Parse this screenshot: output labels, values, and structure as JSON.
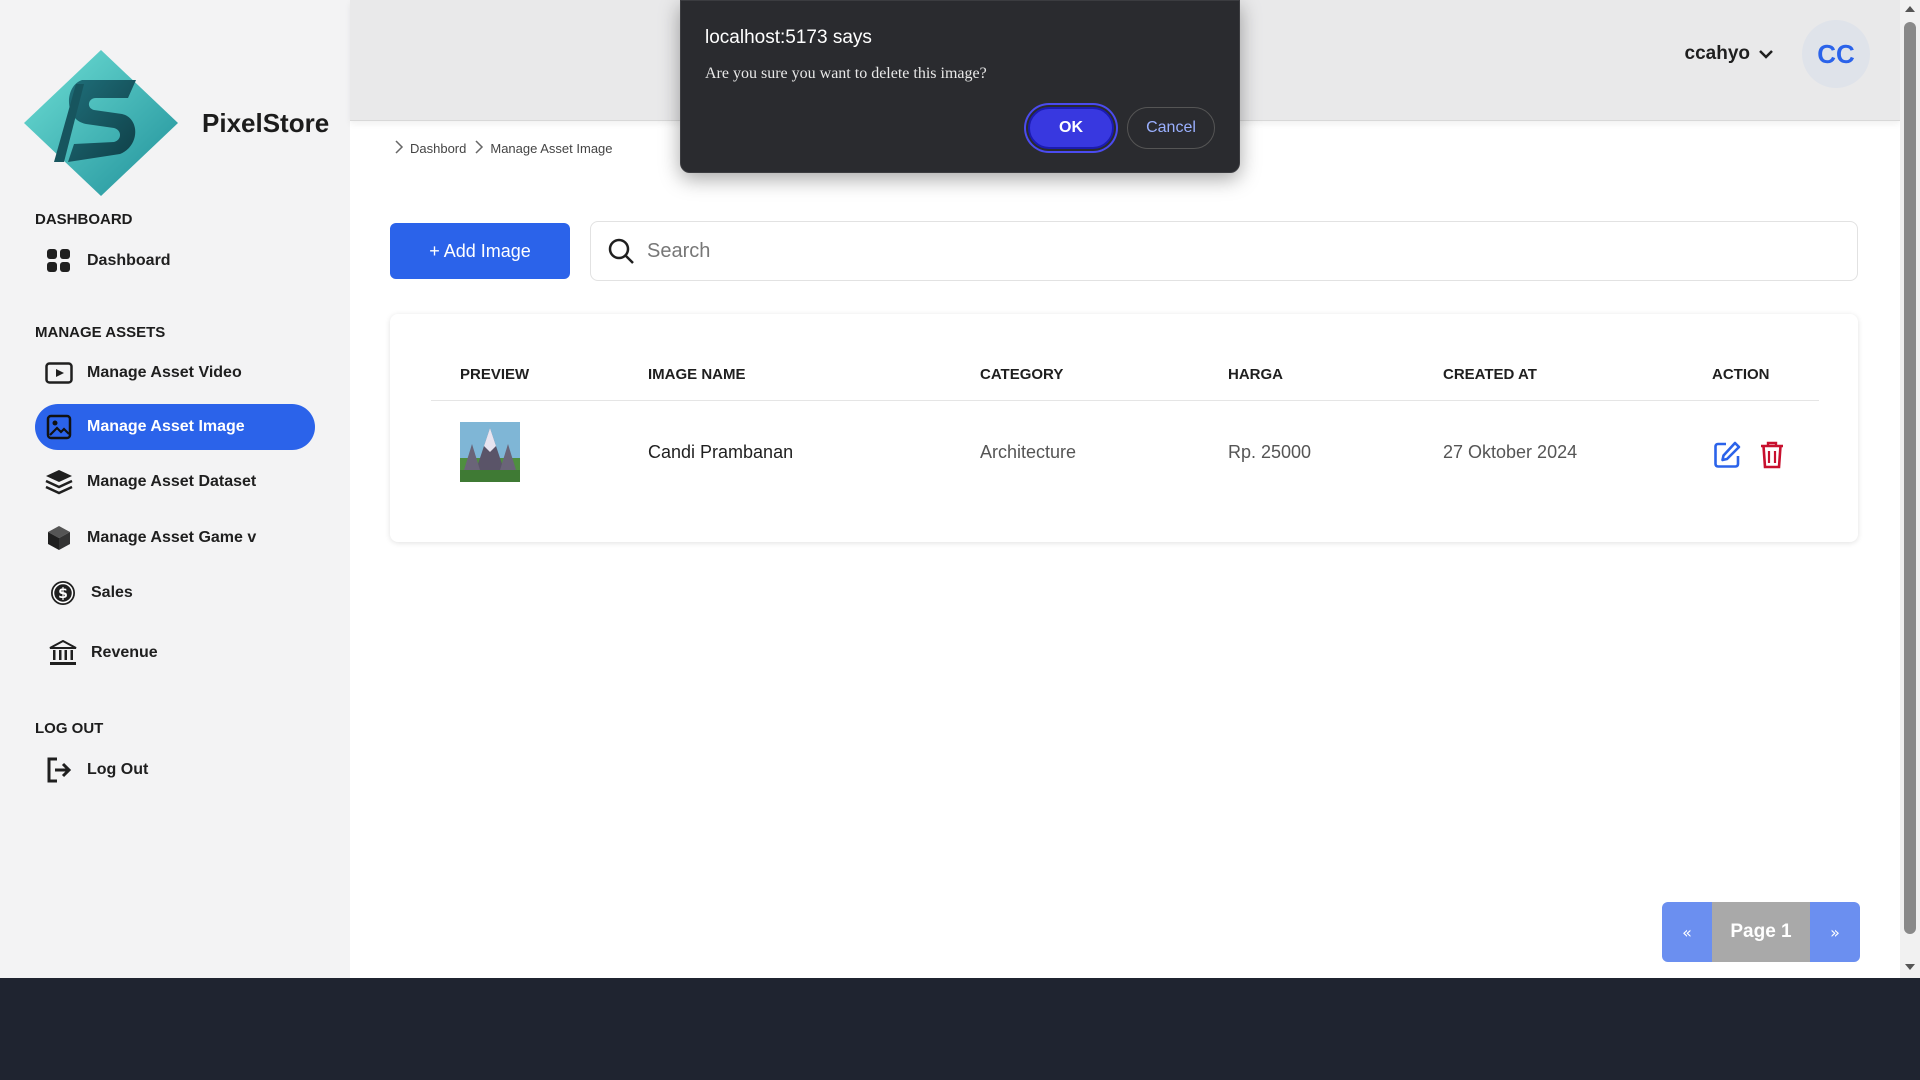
{
  "brand": {
    "name": "PixelStore",
    "logo_icon": "pixelstore-logo-icon"
  },
  "sidebar": {
    "sections": [
      {
        "title": "DASHBOARD"
      },
      {
        "title": "MANAGE ASSETS"
      },
      {
        "title": "LOG OUT"
      }
    ],
    "items": [
      {
        "label": "Dashboard",
        "icon": "grid-icon"
      },
      {
        "label": "Manage Asset Video",
        "icon": "video-icon"
      },
      {
        "label": "Manage Asset Image",
        "icon": "image-icon",
        "active": true
      },
      {
        "label": "Manage Asset Dataset",
        "icon": "layers-icon"
      },
      {
        "label": "Manage Asset Game  v",
        "icon": "cube-icon"
      },
      {
        "label": "Sales",
        "icon": "dollar-icon"
      },
      {
        "label": "Revenue",
        "icon": "bank-icon"
      },
      {
        "label": "Log Out",
        "icon": "logout-icon"
      }
    ]
  },
  "header": {
    "username": "ccahyo",
    "avatar_initials": "CC"
  },
  "breadcrumb": [
    "Dashbord",
    "Manage Asset Image"
  ],
  "toolbar": {
    "add_label": "+ Add Image",
    "search_placeholder": "Search"
  },
  "table": {
    "columns": [
      "PREVIEW",
      "IMAGE NAME",
      "CATEGORY",
      "HARGA",
      "CREATED AT",
      "ACTION"
    ],
    "rows": [
      {
        "name": "Candi Prambanan",
        "category": "Architecture",
        "harga": "Rp. 25000",
        "created_at": "27 Oktober 2024"
      }
    ]
  },
  "pagination": {
    "prev": "«",
    "page_label": "Page 1",
    "next": "»"
  },
  "dialog": {
    "title": "localhost:5173 says",
    "message": "Are you sure you want to delete this image?",
    "ok_label": "OK",
    "cancel_label": "Cancel"
  },
  "colors": {
    "accent": "#2b63ea",
    "danger": "#c8102e",
    "dialog_bg": "#2a2b2f",
    "ok_button": "#3838e0"
  }
}
